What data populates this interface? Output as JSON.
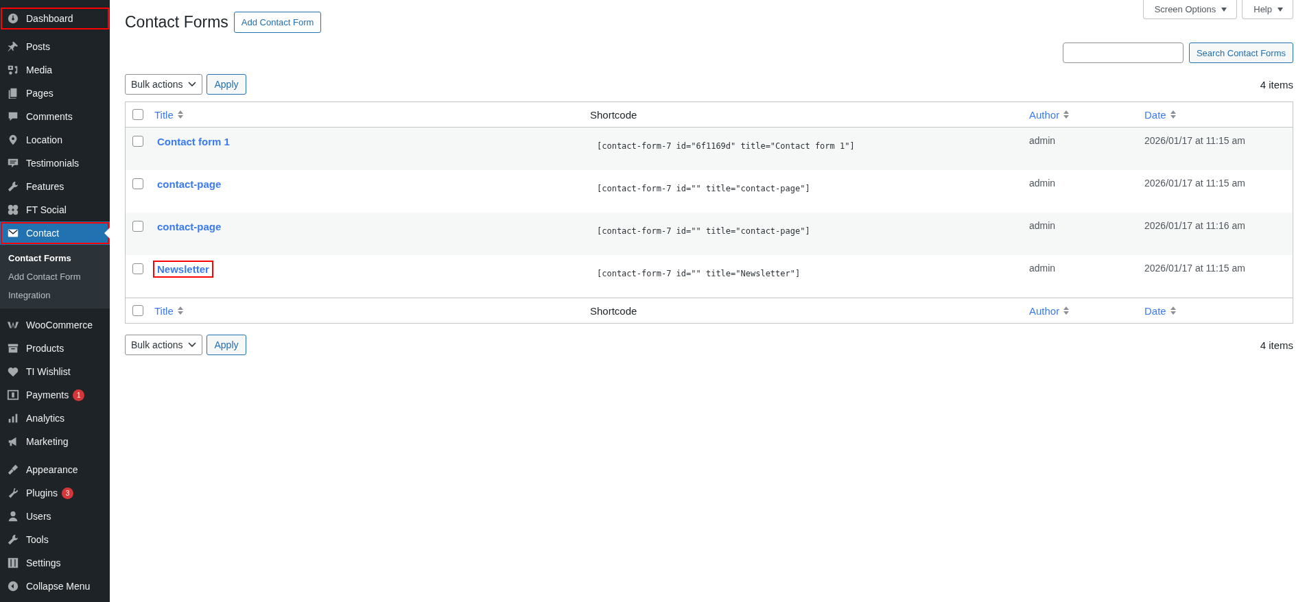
{
  "sidebar": {
    "groups": [
      [
        {
          "label": "Dashboard",
          "selected": false,
          "highlighted": true
        }
      ],
      [
        {
          "label": "Posts",
          "selected": false,
          "highlighted": false
        },
        {
          "label": "Media",
          "selected": false,
          "highlighted": false
        },
        {
          "label": "Pages",
          "selected": false,
          "highlighted": false
        },
        {
          "label": "Comments",
          "selected": false,
          "highlighted": false
        },
        {
          "label": "Location",
          "selected": false,
          "highlighted": false
        },
        {
          "label": "Testimonials",
          "selected": false,
          "highlighted": false
        },
        {
          "label": "Features",
          "selected": false,
          "highlighted": false
        },
        {
          "label": "FT Social",
          "selected": false,
          "highlighted": false
        },
        {
          "label": "Contact",
          "selected": true,
          "highlighted": true,
          "children": [
            {
              "label": "Contact Forms",
              "selected": true
            },
            {
              "label": "Add Contact Form",
              "selected": false
            },
            {
              "label": "Integration",
              "selected": false
            }
          ]
        }
      ],
      [
        {
          "label": "WooCommerce",
          "selected": false,
          "highlighted": false
        },
        {
          "label": "Products",
          "selected": false,
          "highlighted": false
        },
        {
          "label": "TI Wishlist",
          "selected": false,
          "highlighted": false
        },
        {
          "label": "Payments",
          "selected": false,
          "highlighted": false,
          "badge": "1"
        },
        {
          "label": "Analytics",
          "selected": false,
          "highlighted": false
        },
        {
          "label": "Marketing",
          "selected": false,
          "highlighted": false
        }
      ],
      [
        {
          "label": "Appearance",
          "selected": false,
          "highlighted": false
        },
        {
          "label": "Plugins",
          "selected": false,
          "highlighted": false,
          "badge": "3"
        },
        {
          "label": "Users",
          "selected": false,
          "highlighted": false
        },
        {
          "label": "Tools",
          "selected": false,
          "highlighted": false
        },
        {
          "label": "Settings",
          "selected": false,
          "highlighted": false
        },
        {
          "label": "Collapse Menu",
          "selected": false,
          "highlighted": false
        }
      ]
    ]
  },
  "header": {
    "title": "Contact Forms",
    "add_button": "Add Contact Form",
    "screen_options": "Screen Options",
    "help": "Help"
  },
  "search": {
    "button": "Search Contact Forms"
  },
  "top_actions": {
    "bulk_actions": "Bulk actions",
    "apply": "Apply",
    "count": "4 items"
  },
  "table": {
    "select_all_checked": false,
    "footer_select_all_checked": false,
    "columns": [
      {
        "label": "Title",
        "sortable": true
      },
      {
        "label": "Shortcode",
        "sortable": false
      },
      {
        "label": "Author",
        "sortable": true
      },
      {
        "label": "Date",
        "sortable": true
      }
    ],
    "rows": [
      {
        "title": "Contact form 1",
        "shortcode": "[contact-form-7 id=\"6f1169d\" title=\"Contact form 1\"]",
        "author": "admin",
        "date": "2026/01/17 at 11:15 am",
        "checked": false,
        "highlighted": false
      },
      {
        "title": "contact-page",
        "shortcode": "[contact-form-7 id=\"\" title=\"contact-page\"]",
        "author": "admin",
        "date": "2026/01/17 at 11:15 am",
        "checked": false,
        "highlighted": false
      },
      {
        "title": "contact-page",
        "shortcode": "[contact-form-7 id=\"\" title=\"contact-page\"]",
        "author": "admin",
        "date": "2026/01/17 at 11:16 am",
        "checked": false,
        "highlighted": false
      },
      {
        "title": "Newsletter",
        "shortcode": "[contact-form-7 id=\"\" title=\"Newsletter\"]",
        "author": "admin",
        "date": "2026/01/17 at 11:15 am",
        "checked": false,
        "highlighted": true
      }
    ],
    "footer_columns": [
      {
        "label": "Title",
        "sortable": true
      },
      {
        "label": "Shortcode",
        "sortable": false
      },
      {
        "label": "Author",
        "sortable": true
      },
      {
        "label": "Date",
        "sortable": true
      }
    ]
  },
  "bottom_actions": {
    "bulk_actions": "Bulk actions",
    "apply": "Apply",
    "count": "4 items"
  }
}
